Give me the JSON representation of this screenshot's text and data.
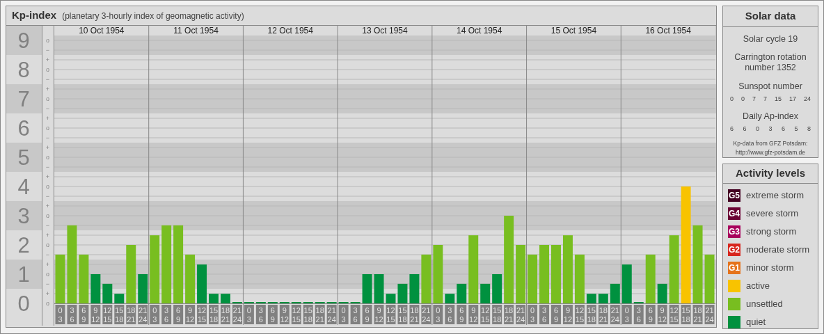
{
  "title": "Kp-index",
  "subtitle": "(planetary 3-hourly index of geomagnetic activity)",
  "chart": {
    "days": [
      {
        "date": "10 Oct 1954",
        "slots": [
          {
            "start": "0",
            "end": "3",
            "color": "#78be20"
          },
          {
            "start": "3",
            "end": "6",
            "color": "#78be20"
          },
          {
            "start": "6",
            "end": "9",
            "color": "#78be20"
          },
          {
            "start": "9",
            "end": "12",
            "color": "#00913f"
          },
          {
            "start": "12",
            "end": "15",
            "color": "#00913f"
          },
          {
            "start": "15",
            "end": "18",
            "color": "#00913f"
          },
          {
            "start": "18",
            "end": "21",
            "color": "#78be20"
          },
          {
            "start": "21",
            "end": "24",
            "color": "#00913f"
          }
        ]
      },
      {
        "date": "11 Oct 1954",
        "slots": [
          {
            "start": "0",
            "end": "3",
            "color": "#78be20"
          },
          {
            "start": "3",
            "end": "6",
            "color": "#78be20"
          },
          {
            "start": "6",
            "end": "9",
            "color": "#78be20"
          },
          {
            "start": "9",
            "end": "12",
            "color": "#78be20"
          },
          {
            "start": "12",
            "end": "15",
            "color": "#00913f"
          },
          {
            "start": "15",
            "end": "18",
            "color": "#00913f"
          },
          {
            "start": "18",
            "end": "21",
            "color": "#00913f"
          },
          {
            "start": "21",
            "end": "24",
            "color": "#00913f"
          }
        ]
      },
      {
        "date": "12 Oct 1954",
        "slots": [
          {
            "start": "0",
            "end": "3",
            "color": "#00913f"
          },
          {
            "start": "3",
            "end": "6",
            "color": "#00913f"
          },
          {
            "start": "6",
            "end": "9",
            "color": "#00913f"
          },
          {
            "start": "9",
            "end": "12",
            "color": "#00913f"
          },
          {
            "start": "12",
            "end": "15",
            "color": "#00913f"
          },
          {
            "start": "15",
            "end": "18",
            "color": "#00913f"
          },
          {
            "start": "18",
            "end": "21",
            "color": "#00913f"
          },
          {
            "start": "21",
            "end": "24",
            "color": "#00913f"
          }
        ]
      },
      {
        "date": "13 Oct 1954",
        "slots": [
          {
            "start": "0",
            "end": "3",
            "color": "#00913f"
          },
          {
            "start": "3",
            "end": "6",
            "color": "#00913f"
          },
          {
            "start": "6",
            "end": "9",
            "color": "#00913f"
          },
          {
            "start": "9",
            "end": "12",
            "color": "#00913f"
          },
          {
            "start": "12",
            "end": "15",
            "color": "#00913f"
          },
          {
            "start": "15",
            "end": "18",
            "color": "#00913f"
          },
          {
            "start": "18",
            "end": "21",
            "color": "#00913f"
          },
          {
            "start": "21",
            "end": "24",
            "color": "#78be20"
          }
        ]
      },
      {
        "date": "14 Oct 1954",
        "slots": [
          {
            "start": "0",
            "end": "3",
            "color": "#78be20"
          },
          {
            "start": "3",
            "end": "6",
            "color": "#00913f"
          },
          {
            "start": "6",
            "end": "9",
            "color": "#00913f"
          },
          {
            "start": "9",
            "end": "12",
            "color": "#78be20"
          },
          {
            "start": "12",
            "end": "15",
            "color": "#00913f"
          },
          {
            "start": "15",
            "end": "18",
            "color": "#00913f"
          },
          {
            "start": "18",
            "end": "21",
            "color": "#78be20"
          },
          {
            "start": "21",
            "end": "24",
            "color": "#78be20"
          }
        ]
      },
      {
        "date": "15 Oct 1954",
        "slots": [
          {
            "start": "0",
            "end": "3",
            "color": "#78be20"
          },
          {
            "start": "3",
            "end": "6",
            "color": "#78be20"
          },
          {
            "start": "6",
            "end": "9",
            "color": "#78be20"
          },
          {
            "start": "9",
            "end": "12",
            "color": "#78be20"
          },
          {
            "start": "12",
            "end": "15",
            "color": "#78be20"
          },
          {
            "start": "15",
            "end": "18",
            "color": "#00913f"
          },
          {
            "start": "18",
            "end": "21",
            "color": "#00913f"
          },
          {
            "start": "21",
            "end": "24",
            "color": "#00913f"
          }
        ]
      },
      {
        "date": "16 Oct 1954",
        "slots": [
          {
            "start": "0",
            "end": "3",
            "color": "#00913f"
          },
          {
            "start": "3",
            "end": "6",
            "color": "#00913f"
          },
          {
            "start": "6",
            "end": "9",
            "color": "#78be20"
          },
          {
            "start": "9",
            "end": "12",
            "color": "#00913f"
          },
          {
            "start": "12",
            "end": "15",
            "color": "#78be20"
          },
          {
            "start": "15",
            "end": "18",
            "color": "#f8c300"
          },
          {
            "start": "18",
            "end": "21",
            "color": "#78be20"
          },
          {
            "start": "21",
            "end": "24",
            "color": "#78be20"
          }
        ]
      }
    ],
    "minor_ticks": [
      "o",
      "−",
      "+",
      "o",
      "−",
      "+",
      "o",
      "−",
      "+",
      "o",
      "−",
      "+",
      "o",
      "−",
      "+",
      "o",
      "−",
      "+",
      "o",
      "−",
      "+",
      "o",
      "−",
      "+",
      "o",
      "−",
      "+",
      "o"
    ],
    "chart_data": {
      "type": "bar",
      "ylim": [
        0,
        9.5
      ],
      "grid": true,
      "yticks": [
        {
          "value": 9,
          "label": "9"
        },
        {
          "value": 8,
          "label": "8"
        },
        {
          "value": 7,
          "label": "7"
        },
        {
          "value": 6,
          "label": "6"
        },
        {
          "value": 5,
          "label": "5"
        },
        {
          "value": 4,
          "label": "4"
        },
        {
          "value": 3,
          "label": "3"
        },
        {
          "value": 2,
          "label": "2"
        },
        {
          "value": 1,
          "label": "1"
        },
        {
          "value": 0,
          "label": "0"
        }
      ],
      "values": [
        1.67,
        2.67,
        1.67,
        1,
        0.67,
        0.33,
        2,
        1,
        2.33,
        2.67,
        2.67,
        1.67,
        1.33,
        0.33,
        0.33,
        0,
        0,
        0,
        0,
        0,
        0,
        0,
        0,
        0,
        0,
        0,
        1,
        1,
        0.33,
        0.67,
        1,
        1.67,
        2,
        0.33,
        0.67,
        2.33,
        0.67,
        1,
        3,
        2,
        1.67,
        2,
        2,
        2.33,
        1.67,
        0.33,
        0.33,
        0.67,
        1.33,
        0,
        1.67,
        0.67,
        2.33,
        4,
        2.67,
        1.67
      ]
    }
  },
  "solar": {
    "title": "Solar data",
    "cycle": "Solar cycle 19",
    "rotation": "Carrington rotation number 1352",
    "sunspot_title": "Sunspot number",
    "sunspots": [
      "0",
      "0",
      "7",
      "7",
      "15",
      "17",
      "24"
    ],
    "ap_title": "Daily Ap-index",
    "ap": [
      "6",
      "6",
      "0",
      "3",
      "6",
      "5",
      "8"
    ],
    "source": "Kp-data from GFZ Potsdam:",
    "url": "http://www.gfz-potsdam.de"
  },
  "legend": {
    "title": "Activity levels",
    "items": [
      {
        "badge": "G5",
        "label": "extreme storm",
        "color": "#430021"
      },
      {
        "badge": "G4",
        "label": "severe storm",
        "color": "#6b0033"
      },
      {
        "badge": "G3",
        "label": "strong storm",
        "color": "#a8005c"
      },
      {
        "badge": "G2",
        "label": "moderate storm",
        "color": "#d7261e"
      },
      {
        "badge": "G1",
        "label": "minor storm",
        "color": "#e5731b"
      },
      {
        "label": "active",
        "color": "#f8c300"
      },
      {
        "label": "unsettled",
        "color": "#78be20"
      },
      {
        "label": "quiet",
        "color": "#00913f"
      }
    ]
  }
}
